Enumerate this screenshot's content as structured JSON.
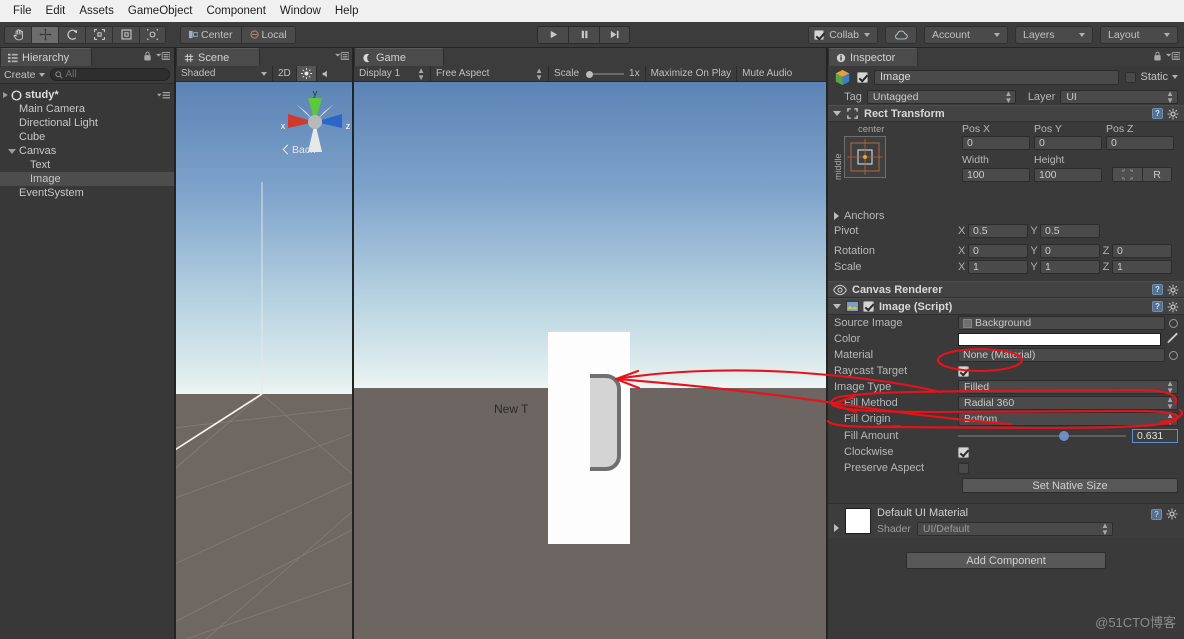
{
  "menubar": {
    "items": [
      "File",
      "Edit",
      "Assets",
      "GameObject",
      "Component",
      "Window",
      "Help"
    ]
  },
  "toolbar": {
    "tools": [
      "hand-tool",
      "move-tool",
      "rotate-tool",
      "scale-tool",
      "rect-tool",
      "transform-tool"
    ],
    "pivot_mode": "Center",
    "pivot_rotation": "Local",
    "play": "play-button",
    "pause": "pause-button",
    "step": "step-button",
    "collab": "Collab",
    "cloud": "cloud-icon",
    "account": "Account",
    "layers": "Layers",
    "layout": "Layout"
  },
  "hierarchy": {
    "tab": "Hierarchy",
    "create": "Create",
    "search_placeholder": "All",
    "scene_name": "study*",
    "items": [
      {
        "label": "Main Camera",
        "indent": 1,
        "expandable": false,
        "selected": false
      },
      {
        "label": "Directional Light",
        "indent": 1,
        "expandable": false,
        "selected": false
      },
      {
        "label": "Cube",
        "indent": 1,
        "expandable": false,
        "selected": false
      },
      {
        "label": "Canvas",
        "indent": 1,
        "expandable": true,
        "selected": false
      },
      {
        "label": "Text",
        "indent": 2,
        "expandable": false,
        "selected": false
      },
      {
        "label": "Image",
        "indent": 2,
        "expandable": false,
        "selected": true
      },
      {
        "label": "EventSystem",
        "indent": 1,
        "expandable": false,
        "selected": false
      }
    ]
  },
  "scene": {
    "tab": "Scene",
    "shading": "Shaded",
    "mode_2d": "2D",
    "lighting": "lighting-icon",
    "audio": "audio-icon",
    "gizmo": {
      "x": "x",
      "y": "y",
      "z": "z",
      "view": "Back"
    }
  },
  "game": {
    "tab": "Game",
    "display": "Display 1",
    "aspect": "Free Aspect",
    "scale_label": "Scale",
    "scale_value": "1x",
    "maximize": "Maximize On Play",
    "mute": "Mute Audio",
    "text_object": "New T"
  },
  "inspector": {
    "tab": "Inspector",
    "object_name": "Image",
    "enabled": true,
    "static_label": "Static",
    "tag_label": "Tag",
    "tag_value": "Untagged",
    "layer_label": "Layer",
    "layer_value": "UI",
    "rect_transform": {
      "title": "Rect Transform",
      "anchor_h": "center",
      "anchor_v": "middle",
      "pos_x_label": "Pos X",
      "pos_y_label": "Pos Y",
      "pos_z_label": "Pos Z",
      "pos_x": "0",
      "pos_y": "0",
      "pos_z": "0",
      "width_label": "Width",
      "height_label": "Height",
      "width": "100",
      "height": "100",
      "blueprint_label": "R",
      "anchors_label": "Anchors",
      "pivot_label": "Pivot",
      "pivot_x": "0.5",
      "pivot_y": "0.5",
      "rotation_label": "Rotation",
      "rot_x": "0",
      "rot_y": "0",
      "rot_z": "0",
      "scale_label": "Scale",
      "scale_x": "1",
      "scale_y": "1",
      "scale_z": "1"
    },
    "canvas_renderer": {
      "title": "Canvas Renderer"
    },
    "image_script": {
      "title": "Image (Script)",
      "enabled": true,
      "source_image_label": "Source Image",
      "source_image_value": "Background",
      "color_label": "Color",
      "color_value": "#FFFFFF",
      "material_label": "Material",
      "material_value": "None (Material)",
      "raycast_label": "Raycast Target",
      "raycast_checked": true,
      "image_type_label": "Image Type",
      "image_type_value": "Filled",
      "fill_method_label": "Fill Method",
      "fill_method_value": "Radial 360",
      "fill_origin_label": "Fill Origin",
      "fill_origin_value": "Bottom",
      "fill_amount_label": "Fill Amount",
      "fill_amount_value": "0.631",
      "fill_amount_percent": 63.1,
      "clockwise_label": "Clockwise",
      "clockwise_checked": true,
      "preserve_label": "Preserve Aspect",
      "preserve_checked": false,
      "native_size_button": "Set Native Size"
    },
    "material": {
      "title": "Default UI Material",
      "shader_label": "Shader",
      "shader_value": "UI/Default"
    },
    "add_component": "Add Component"
  },
  "watermark": "@51CTO博客",
  "colors": {
    "accent": "#5f8fd0",
    "annotation": "#e8121a",
    "panel": "#383838"
  }
}
